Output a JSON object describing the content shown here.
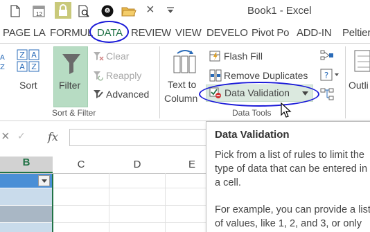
{
  "window": {
    "title": "Book1 - Excel"
  },
  "quick_access": {
    "icons": [
      "new-document-icon",
      "calendar-icon",
      "lock-icon",
      "print-preview-icon",
      "eight-ball-icon",
      "open-folder-icon",
      "close-icon",
      "dropdown-arrow-icon"
    ],
    "calendar_badge": "12"
  },
  "tabs": [
    {
      "label": "PAGE LA"
    },
    {
      "label": "FORMUL"
    },
    {
      "label": "DATA"
    },
    {
      "label": "REVIEW"
    },
    {
      "label": "VIEW"
    },
    {
      "label": "DEVELO"
    },
    {
      "label": "Pivot Po"
    },
    {
      "label": "ADD-IN"
    },
    {
      "label": "Peltier"
    }
  ],
  "ribbon": {
    "sort_filter": {
      "sort_label": "Sort",
      "filter_label": "Filter",
      "clear_label": "Clear",
      "reapply_label": "Reapply",
      "advanced_label": "Advanced",
      "group_label": "Sort & Filter"
    },
    "data_tools": {
      "text_to_columns_line1": "Text to",
      "text_to_columns_line2": "Column",
      "flash_fill_label": "Flash Fill",
      "remove_duplicates_label": "Remove Duplicates",
      "data_validation_label": "Data Validation",
      "group_label": "Data Tools"
    },
    "outline_label": "Outli"
  },
  "formula_bar": {
    "fx_label": "fx",
    "close_glyph": "×",
    "dots": "⋮"
  },
  "grid": {
    "columns": [
      "B",
      "C",
      "D",
      "E"
    ],
    "selected_column": "B"
  },
  "tooltip": {
    "title": "Data Validation",
    "lines": [
      "Pick from a list of rules to limit the",
      "type of data that can be entered in",
      "a cell.",
      "",
      "For example, you can provide a list",
      "of values, like 1, 2, and 3, or only"
    ]
  },
  "colors": {
    "accent": "#217346",
    "annotation": "#1a1ad8",
    "filter_bg": "#b7dcc3"
  }
}
